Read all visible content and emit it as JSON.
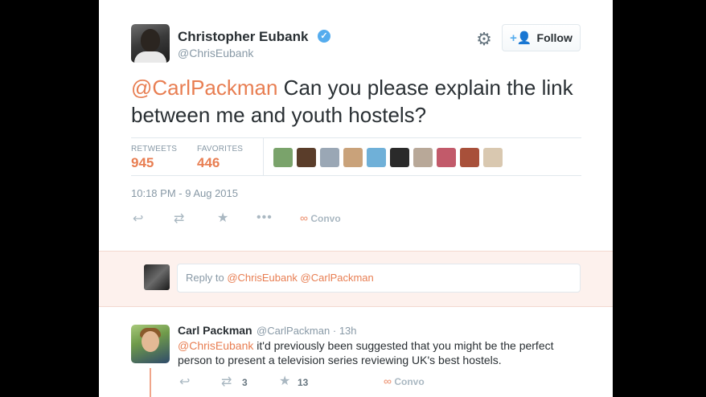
{
  "tweet": {
    "author_name": "Christopher Eubank",
    "verified_icon": "verified-badge-icon",
    "author_handle": "@ChrisEubank",
    "follow_label": "Follow",
    "text_mention": "@CarlPackman",
    "text_body": " Can you please explain the link between me and youth hostels?",
    "stats": {
      "retweets_label": "RETWEETS",
      "retweets_value": "945",
      "favorites_label": "FAVORITES",
      "favorites_value": "446"
    },
    "favoriters": [
      {
        "icon": "favoriter-avatar-1",
        "color": "#7aa36b"
      },
      {
        "icon": "favoriter-avatar-2",
        "color": "#5a3d2a"
      },
      {
        "icon": "favoriter-avatar-3",
        "color": "#9aa7b5"
      },
      {
        "icon": "favoriter-avatar-4",
        "color": "#c9a27a"
      },
      {
        "icon": "favoriter-avatar-5",
        "color": "#6fb0d8"
      },
      {
        "icon": "favoriter-avatar-6",
        "color": "#2a2a2a"
      },
      {
        "icon": "favoriter-avatar-7",
        "color": "#b8a898"
      },
      {
        "icon": "favoriter-avatar-8",
        "color": "#c25a6a"
      },
      {
        "icon": "favoriter-avatar-9",
        "color": "#a8503a"
      },
      {
        "icon": "favoriter-avatar-10",
        "color": "#d9c8b0"
      }
    ],
    "timestamp": "10:18 PM - 9 Aug 2015",
    "actions": {
      "reply_icon": "reply-icon",
      "retweet_icon": "retweet-icon",
      "favorite_icon": "star-icon",
      "more_icon": "more-icon",
      "convo_label": "Convo"
    }
  },
  "reply_composer": {
    "placeholder_prefix": "Reply to ",
    "mentions": "@ChrisEubank @CarlPackman"
  },
  "reply_tweet": {
    "author_name": "Carl Packman",
    "author_handle": "@CarlPackman",
    "separator": "·",
    "time": "13h",
    "text_mention": "@ChrisEubank",
    "text_body": " it'd previously been suggested that you might be the perfect person to present a television series reviewing UK's best hostels.",
    "retweet_count": "3",
    "favorite_count": "13",
    "convo_label": "Convo"
  },
  "colors": {
    "accent": "#e87e52",
    "muted": "#8899a6",
    "verified": "#55acee",
    "reply_bg": "#fdf1ed"
  }
}
